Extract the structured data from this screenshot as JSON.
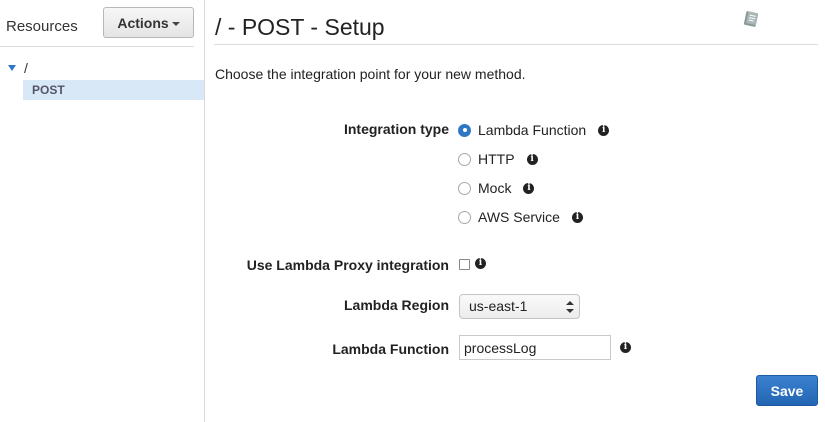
{
  "left_pane": {
    "title": "Resources",
    "actions_label": "Actions",
    "tree": {
      "root_label": "/",
      "child_label": "POST"
    }
  },
  "main": {
    "title": "/ - POST - Setup",
    "intro": "Choose the integration point for your new method.",
    "integration_type": {
      "label": "Integration type",
      "selected": "Lambda Function",
      "options": [
        "Lambda Function",
        "HTTP",
        "Mock",
        "AWS Service"
      ]
    },
    "proxy": {
      "label": "Use Lambda Proxy integration",
      "checked": false
    },
    "region": {
      "label": "Lambda Region",
      "value": "us-east-1"
    },
    "function": {
      "label": "Lambda Function",
      "value": "processLog"
    },
    "save_label": "Save"
  },
  "colors": {
    "accent": "#2f77c6",
    "save_button": "#2b70c0",
    "tree_selected_bg": "#d9e8f7"
  },
  "icons": {
    "info": "info-icon",
    "help": "book-icon",
    "expand": "caret-down-icon"
  }
}
